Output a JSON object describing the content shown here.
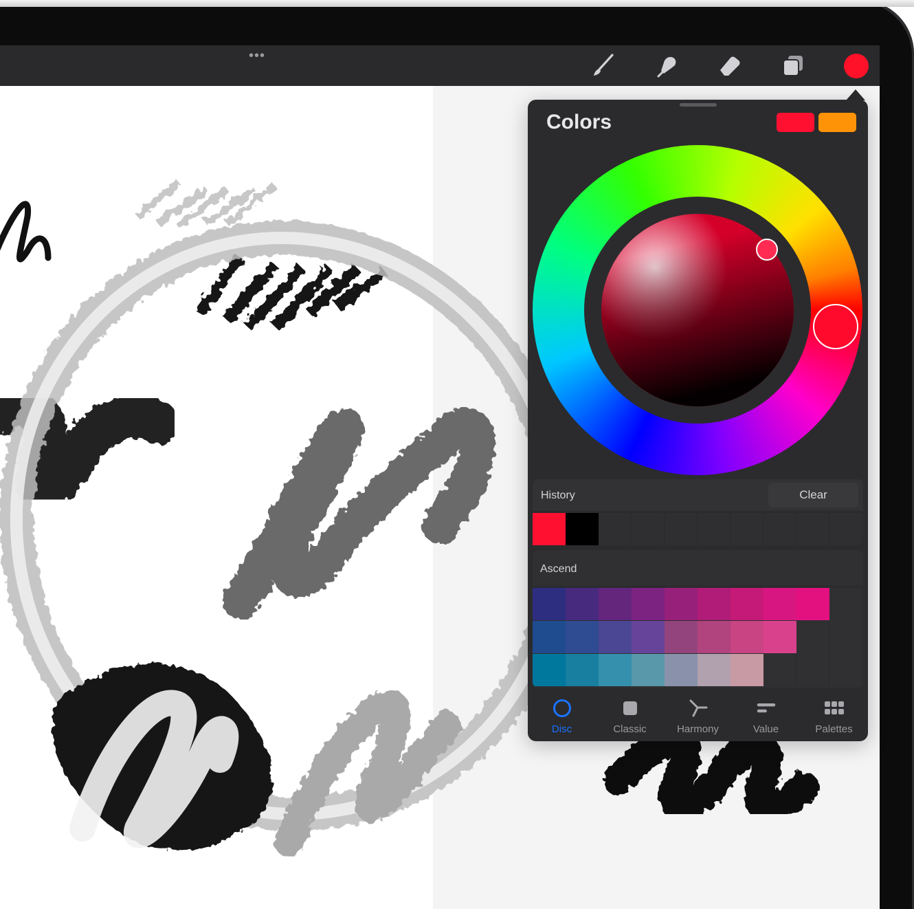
{
  "toolbar": {
    "more_icon": "more-dots-icon",
    "tools": [
      {
        "name": "brush-icon"
      },
      {
        "name": "smudge-icon"
      },
      {
        "name": "eraser-icon"
      },
      {
        "name": "layers-icon"
      }
    ],
    "current_color": "#ff1129"
  },
  "colors_panel": {
    "title": "Colors",
    "primary_color": "#ff1031",
    "secondary_color": "#ff9308",
    "history": {
      "label": "History",
      "clear_label": "Clear",
      "swatches": [
        "#ff1031",
        "#000000"
      ]
    },
    "palette": {
      "name": "Ascend",
      "rows": [
        [
          "#2e2e80",
          "#472a7e",
          "#64257d",
          "#7c2281",
          "#97207a",
          "#b01c77",
          "#c51a77",
          "#d81681",
          "#e2117f"
        ],
        [
          "#1e4c8f",
          "#2f4b91",
          "#4b4794",
          "#66449a",
          "#94447c",
          "#b1437f",
          "#c84483",
          "#da418d"
        ],
        [
          "#00789e",
          "#187fa1",
          "#3490ac",
          "#5998ab",
          "#8a92ab",
          "#b1a0ad",
          "#c89aa4"
        ]
      ]
    },
    "tabs": [
      {
        "label": "Disc",
        "icon": "disc-icon",
        "active": true
      },
      {
        "label": "Classic",
        "icon": "classic-square-icon",
        "active": false
      },
      {
        "label": "Harmony",
        "icon": "harmony-icon",
        "active": false
      },
      {
        "label": "Value",
        "icon": "value-sliders-icon",
        "active": false
      },
      {
        "label": "Palettes",
        "icon": "palettes-grid-icon",
        "active": false
      }
    ]
  }
}
